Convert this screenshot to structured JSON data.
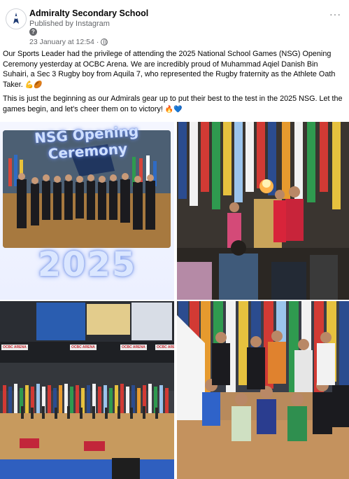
{
  "post": {
    "page_name": "Admiralty Secondary School",
    "published_via": "Published by Instagram",
    "meta_icon": "?",
    "timestamp": "23 January at 12:54",
    "separator": "·",
    "privacy_icon": "globe-icon",
    "more_label": "···",
    "paragraph_1": "Our Sports Leader had the privilege of attending the 2025 National School Games (NSG) Opening Ceremony yesterday at OCBC Arena. We are incredibly proud of Muhammad Aqiel Danish Bin Suhairi, a Sec 3 Rugby boy from Aquila 7, who represented the Rugby fraternity as the Athlete Oath Taker.",
    "paragraph_1_emoji": "💪🏉",
    "paragraph_2": "This is just the beginning as our Admirals gear up to put their best to the test in the 2025 NSG. Let the games begin, and let's cheer them on to victory!",
    "paragraph_2_emoji": "🔥💙"
  },
  "photos": {
    "photo_1": {
      "title_text": "NSG Opening Ceremony",
      "year_text": "2025"
    },
    "photo_3": {
      "sign_1": "OCBC ARENA",
      "sign_2": "OCBC ARENA",
      "sign_3": "OCBC ARENA",
      "sign_4": "OCBC ARENA"
    }
  },
  "colors": {
    "text_primary": "#050505",
    "text_secondary": "#65676b",
    "accent_glow": "#6f8ee8"
  }
}
